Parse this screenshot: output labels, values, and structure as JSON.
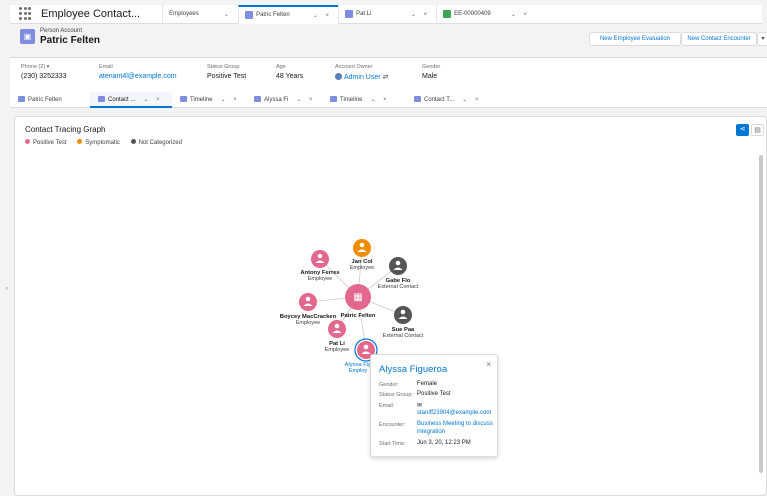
{
  "nav": {
    "app_name": "Employee Contact...",
    "tabs": [
      {
        "label": "Employees"
      },
      {
        "label": "Patric Felten"
      },
      {
        "label": "Pat Li"
      },
      {
        "label": "EE-00000409"
      }
    ]
  },
  "record": {
    "kicker": "Person Account",
    "name": "Patric Felten",
    "buttons": {
      "evaluation": "New Employee Evaluation",
      "encounter": "New Contact Encounter",
      "more": "▾"
    },
    "fields": {
      "phone": {
        "label": "Phone (2) ▾",
        "value": "(230) 3252333"
      },
      "email": {
        "label": "Email",
        "value": "atenant4l@example.com"
      },
      "status": {
        "label": "Status Group",
        "value": "Positive Test"
      },
      "age": {
        "label": "Age",
        "value": "48 Years"
      },
      "owner": {
        "label": "Account Owner",
        "value": "Admin User"
      },
      "gender": {
        "label": "Gender",
        "value": "Male"
      }
    }
  },
  "subtabs": [
    {
      "label": "Patric Felten"
    },
    {
      "label": "Contact ..."
    },
    {
      "label": "Timeline"
    },
    {
      "label": "Alyssa Fi"
    },
    {
      "label": "Timeline"
    },
    {
      "label": "Contact T..."
    }
  ],
  "graph": {
    "title": "Contact Tracing Graph",
    "legend": [
      {
        "label": "Positive Test",
        "color": "#e3688d"
      },
      {
        "label": "Symptomatic",
        "color": "#ef8c00"
      },
      {
        "label": "Not Categorized",
        "color": "#555555"
      }
    ],
    "center": {
      "name": "Patric Felten",
      "color": "#e3688d"
    },
    "nodes": [
      {
        "name": "Jan Col",
        "role": "Employee",
        "color": "#ef8c00"
      },
      {
        "name": "Antony Ferres",
        "role": "Employee",
        "color": "#e3688d"
      },
      {
        "name": "Gabe Flo",
        "role": "External Contact",
        "color": "#555555"
      },
      {
        "name": "Boycey MacCracken",
        "role": "Employee",
        "color": "#e3688d"
      },
      {
        "name": "Sue Paa",
        "role": "External Contact",
        "color": "#555555"
      },
      {
        "name": "Pat Li",
        "role": "Employee",
        "color": "#e3688d"
      },
      {
        "name": "Alyssa Fig",
        "role": "Employ",
        "color": "#e3688d"
      }
    ]
  },
  "popover": {
    "title": "Alyssa Figueroa",
    "close": "×",
    "rows": {
      "gender": {
        "label": "Gender:",
        "value": "Female"
      },
      "status": {
        "label": "Status Group:",
        "value": "Positive Test"
      },
      "email": {
        "label": "Email:",
        "value": "staniff23904@example.com"
      },
      "encounter": {
        "label": "Encounter:",
        "value1": "Business Meeting to discuss",
        "value2": "integration"
      },
      "start": {
        "label": "Start Time:",
        "value": "Jun 3, 20, 12:23 PM"
      }
    }
  }
}
